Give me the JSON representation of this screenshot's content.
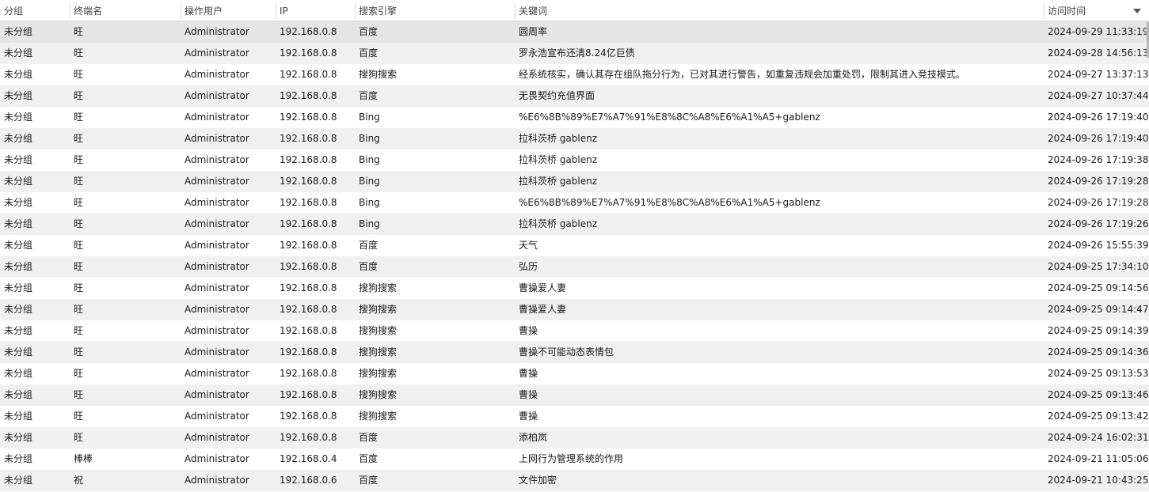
{
  "columns": [
    {
      "label": "分组"
    },
    {
      "label": "终端名"
    },
    {
      "label": "操作用户"
    },
    {
      "label": "IP"
    },
    {
      "label": "搜索引擎"
    },
    {
      "label": "关键词"
    },
    {
      "label": "访问时间"
    }
  ],
  "rows": [
    [
      "未分组",
      "旺",
      "Administrator",
      "192.168.0.8",
      "百度",
      "圆周率",
      "2024-09-29 11:33:19"
    ],
    [
      "未分组",
      "旺",
      "Administrator",
      "192.168.0.8",
      "百度",
      "罗永浩宣布还清8.24亿巨债",
      "2024-09-28 14:56:13"
    ],
    [
      "未分组",
      "旺",
      "Administrator",
      "192.168.0.8",
      "搜狗搜索",
      "经系统核实，确认其存在组队拖分行为，已对其进行警告，如重复违规会加重处罚，限制其进入竞技模式。",
      "2024-09-27 13:37:13"
    ],
    [
      "未分组",
      "旺",
      "Administrator",
      "192.168.0.8",
      "百度",
      "无畏契约充值界面",
      "2024-09-27 10:37:44"
    ],
    [
      "未分组",
      "旺",
      "Administrator",
      "192.168.0.8",
      "Bing",
      "%E6%8B%89%E7%A7%91%E8%8C%A8%E6%A1%A5+gablenz",
      "2024-09-26 17:19:40"
    ],
    [
      "未分组",
      "旺",
      "Administrator",
      "192.168.0.8",
      "Bing",
      "拉科茨桥 gablenz",
      "2024-09-26 17:19:40"
    ],
    [
      "未分组",
      "旺",
      "Administrator",
      "192.168.0.8",
      "Bing",
      "拉科茨桥 gablenz",
      "2024-09-26 17:19:38"
    ],
    [
      "未分组",
      "旺",
      "Administrator",
      "192.168.0.8",
      "Bing",
      "拉科茨桥 gablenz",
      "2024-09-26 17:19:28"
    ],
    [
      "未分组",
      "旺",
      "Administrator",
      "192.168.0.8",
      "Bing",
      "%E6%8B%89%E7%A7%91%E8%8C%A8%E6%A1%A5+gablenz",
      "2024-09-26 17:19:28"
    ],
    [
      "未分组",
      "旺",
      "Administrator",
      "192.168.0.8",
      "Bing",
      "拉科茨桥 gablenz",
      "2024-09-26 17:19:26"
    ],
    [
      "未分组",
      "旺",
      "Administrator",
      "192.168.0.8",
      "百度",
      "天气",
      "2024-09-26 15:55:39"
    ],
    [
      "未分组",
      "旺",
      "Administrator",
      "192.168.0.8",
      "百度",
      "弘历",
      "2024-09-25 17:34:10"
    ],
    [
      "未分组",
      "旺",
      "Administrator",
      "192.168.0.8",
      "搜狗搜索",
      "曹操爱人妻",
      "2024-09-25 09:14:56"
    ],
    [
      "未分组",
      "旺",
      "Administrator",
      "192.168.0.8",
      "搜狗搜索",
      "曹操爱人妻",
      "2024-09-25 09:14:47"
    ],
    [
      "未分组",
      "旺",
      "Administrator",
      "192.168.0.8",
      "搜狗搜索",
      "曹操",
      "2024-09-25 09:14:39"
    ],
    [
      "未分组",
      "旺",
      "Administrator",
      "192.168.0.8",
      "搜狗搜索",
      "曹操不可能动态表情包",
      "2024-09-25 09:14:36"
    ],
    [
      "未分组",
      "旺",
      "Administrator",
      "192.168.0.8",
      "搜狗搜索",
      "曹操",
      "2024-09-25 09:13:53"
    ],
    [
      "未分组",
      "旺",
      "Administrator",
      "192.168.0.8",
      "搜狗搜索",
      "曹操",
      "2024-09-25 09:13:46"
    ],
    [
      "未分组",
      "旺",
      "Administrator",
      "192.168.0.8",
      "搜狗搜索",
      "曹操",
      "2024-09-25 09:13:42"
    ],
    [
      "未分组",
      "旺",
      "Administrator",
      "192.168.0.8",
      "百度",
      "添柏岚",
      "2024-09-24 16:02:31"
    ],
    [
      "未分组",
      "棒棒",
      "Administrator",
      "192.168.0.4",
      "百度",
      "上网行为管理系统的作用",
      "2024-09-21 11:05:06"
    ],
    [
      "未分组",
      "祝",
      "Administrator",
      "192.168.0.6",
      "百度",
      "文件加密",
      "2024-09-21 10:43:25"
    ]
  ],
  "selected_row": 0,
  "sort": {
    "column": 6,
    "direction": "descending",
    "icon": "sort-descending-icon"
  }
}
